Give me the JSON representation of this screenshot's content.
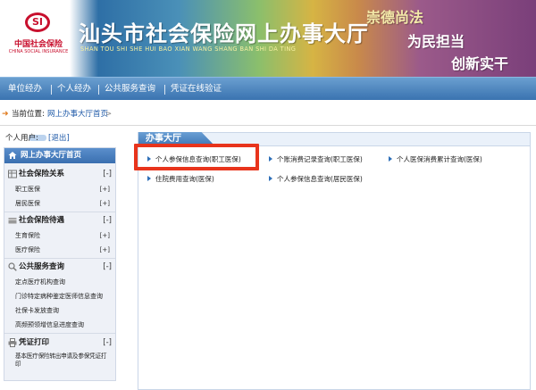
{
  "brand": {
    "logo_mark": "SI",
    "logo_cn": "中国社会保险",
    "logo_en": "CHINA SOCIAL INSURANCE",
    "title": "汕头市社会保险网上办事大厅",
    "subtitle": "SHAN TOU SHI SHE HUI BAO XIAN WANG SHANG BAN SHI DA TING",
    "slogans": [
      "崇德尚法",
      "为民担当",
      "创新实干"
    ]
  },
  "nav": {
    "items": [
      "单位经办",
      "个人经办",
      "公共服务查询",
      "凭证在线验证"
    ]
  },
  "breadcrumb": {
    "label": "当前位置:",
    "link": "网上办事大厅首页",
    "separator": ">"
  },
  "user": {
    "label": "个人用户:",
    "logout": "[退出]"
  },
  "sidebar": {
    "home": "网上办事大厅首页",
    "groups": [
      {
        "title": "社会保险关系",
        "toggle": "[-]",
        "icon": "table-icon",
        "items": [
          {
            "label": "职工医保",
            "toggle": "[+]"
          },
          {
            "label": "居民医保",
            "toggle": "[+]"
          }
        ]
      },
      {
        "title": "社会保险待遇",
        "toggle": "[-]",
        "icon": "card-icon",
        "items": [
          {
            "label": "生育保险",
            "toggle": "[+]"
          },
          {
            "label": "医疗保险",
            "toggle": "[+]"
          }
        ]
      },
      {
        "title": "公共服务查询",
        "toggle": "[-]",
        "icon": "search-icon",
        "items": [
          {
            "label": "定点医疗机构查询"
          },
          {
            "label": "门诊特定病种鉴定医师信息查询"
          },
          {
            "label": "社保卡发放查询"
          },
          {
            "label": "高频预领增信息进度查询"
          }
        ]
      },
      {
        "title": "凭证打印",
        "toggle": "[-]",
        "icon": "printer-icon",
        "items": [
          {
            "label": "基本医疗保险转出申请及参保凭证打印"
          }
        ]
      }
    ]
  },
  "main": {
    "title": "办事大厅",
    "services": [
      "个人参保信息查询(职工医保)",
      "个账消费记录查询(职工医保)",
      "个人医保消费累计查询(医保)",
      "住院费用查询(医保)",
      "个人参保信息查询(居民医保)"
    ]
  },
  "colors": {
    "nav_bg": "#3a73b0",
    "highlight": "#e8341c",
    "link": "#1f5aa8"
  }
}
